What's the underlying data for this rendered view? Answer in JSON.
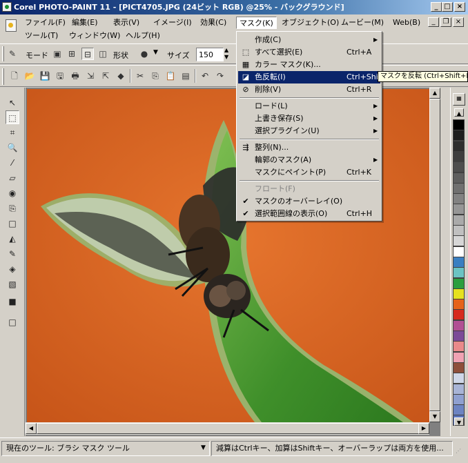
{
  "window": {
    "title": "Corel PHOTO-PAINT 11 - [PICT4705.JPG (24ビット RGB) @25% - バックグラウンド]",
    "controls": [
      "minimize-icon",
      "maximize-icon",
      "close-icon"
    ]
  },
  "menu": {
    "items": [
      "ファイル(F)",
      "編集(E)",
      "表示(V)",
      "イメージ(I)",
      "効果(C)",
      "マスク(K)",
      "オブジェクト(O)",
      "ムービー(M)",
      "Web(B)",
      "ツール(T)",
      "ウィンドウ(W)",
      "ヘルプ(H)"
    ],
    "active": "マスク(K)"
  },
  "property_bar": {
    "mode_label": "モード",
    "shape_label": "形状",
    "size_label": "サイズ",
    "size_value": "150"
  },
  "mask_menu": {
    "items": [
      {
        "label": "作成(C)",
        "shortcut": "",
        "submenu": true,
        "icon": ""
      },
      {
        "label": "すべて選択(E)",
        "shortcut": "Ctrl+A",
        "submenu": false,
        "icon": "select-all-icon"
      },
      {
        "label": "カラー マスク(K)...",
        "shortcut": "",
        "submenu": false,
        "icon": "color-mask-icon"
      },
      {
        "label": "色反転(I)",
        "shortcut": "Ctrl+Shift+I",
        "submenu": false,
        "icon": "invert-icon",
        "highlighted": true
      },
      {
        "label": "削除(V)",
        "shortcut": "Ctrl+R",
        "submenu": false,
        "icon": "delete-mask-icon"
      },
      {
        "label": "ロード(L)",
        "shortcut": "",
        "submenu": true,
        "icon": ""
      },
      {
        "label": "上書き保存(S)",
        "shortcut": "",
        "submenu": true,
        "icon": ""
      },
      {
        "label": "選択プラグイン(U)",
        "shortcut": "",
        "submenu": true,
        "icon": ""
      },
      {
        "label": "整列(N)...",
        "shortcut": "",
        "submenu": false,
        "icon": "align-icon"
      },
      {
        "label": "輪郭のマスク(A)",
        "shortcut": "",
        "submenu": true,
        "icon": ""
      },
      {
        "label": "マスクにペイント(P)",
        "shortcut": "Ctrl+K",
        "submenu": false,
        "icon": ""
      },
      {
        "label": "フロート(F)",
        "shortcut": "",
        "submenu": false,
        "icon": "",
        "disabled": true
      },
      {
        "label": "マスクのオーバーレイ(O)",
        "shortcut": "",
        "submenu": false,
        "icon": "check-icon"
      },
      {
        "label": "選択範囲線の表示(O)",
        "shortcut": "Ctrl+H",
        "submenu": false,
        "icon": "check-icon"
      }
    ]
  },
  "tooltip": "マスクを反転 (Ctrl+Shift+I)",
  "palette": {
    "colors": [
      "#000000",
      "#1e1e1e",
      "#2e2e2e",
      "#3e3e3e",
      "#4e4e4e",
      "#5e5e5e",
      "#707070",
      "#828282",
      "#969696",
      "#aaaaaa",
      "#c0c0c0",
      "#d6d6d6",
      "#ffffff",
      "#3a7fc1",
      "#6bc3c3",
      "#2b9e3f",
      "#e5e11f",
      "#e5631a",
      "#d62a1e",
      "#b14f94",
      "#7b4a97",
      "#e98a8a",
      "#f0a2b3",
      "#8e4f3b",
      "#cfd7e8",
      "#a8b4d6",
      "#8fa0d0",
      "#6d84c2",
      "#5a74bb"
    ]
  },
  "status": {
    "tool": "現在のツール: ブラシ マスク ツール",
    "hint": "減算はCtrlキー、加算はShiftキー、オーバーラップは両方を使用..."
  }
}
